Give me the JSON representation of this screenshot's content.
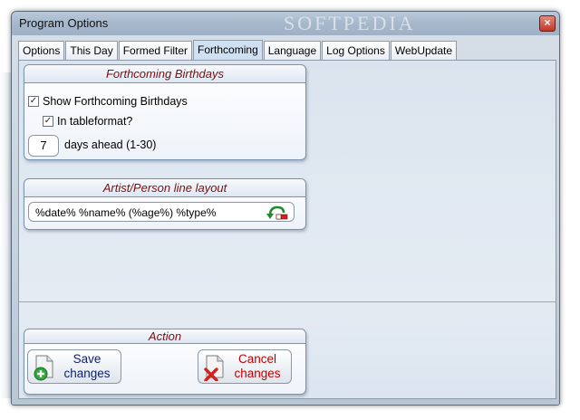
{
  "window": {
    "title": "Program Options",
    "watermark": "SOFTPEDIA",
    "close_label": "×"
  },
  "tabs": [
    {
      "label": "Options"
    },
    {
      "label": "This Day"
    },
    {
      "label": "Formed Filter"
    },
    {
      "label": "Forthcoming"
    },
    {
      "label": "Language"
    },
    {
      "label": "Log Options"
    },
    {
      "label": "WebUpdate"
    }
  ],
  "active_tab": "Forthcoming",
  "birthdays": {
    "title": "Forthcoming Birthdays",
    "show_label": "Show Forthcoming Birthdays",
    "show_checked": true,
    "tableformat_label": "In tableformat?",
    "tableformat_checked": true,
    "days_value": "7",
    "days_label": "days ahead (1-30)",
    "check_glyph": "✓"
  },
  "layout": {
    "title": "Artist/Person line layout",
    "value": "%date% %name% (%age%) %type%",
    "undo_icon": "undo-icon"
  },
  "action": {
    "title": "Action",
    "save_line1": "Save",
    "save_line2": "changes",
    "cancel_line1": "Cancel",
    "cancel_line2": "changes"
  },
  "colors": {
    "group_title": "#7a1010",
    "save_text": "#0b1f6b",
    "cancel_text": "#c00000",
    "active_tab": "#cfe0f2"
  }
}
